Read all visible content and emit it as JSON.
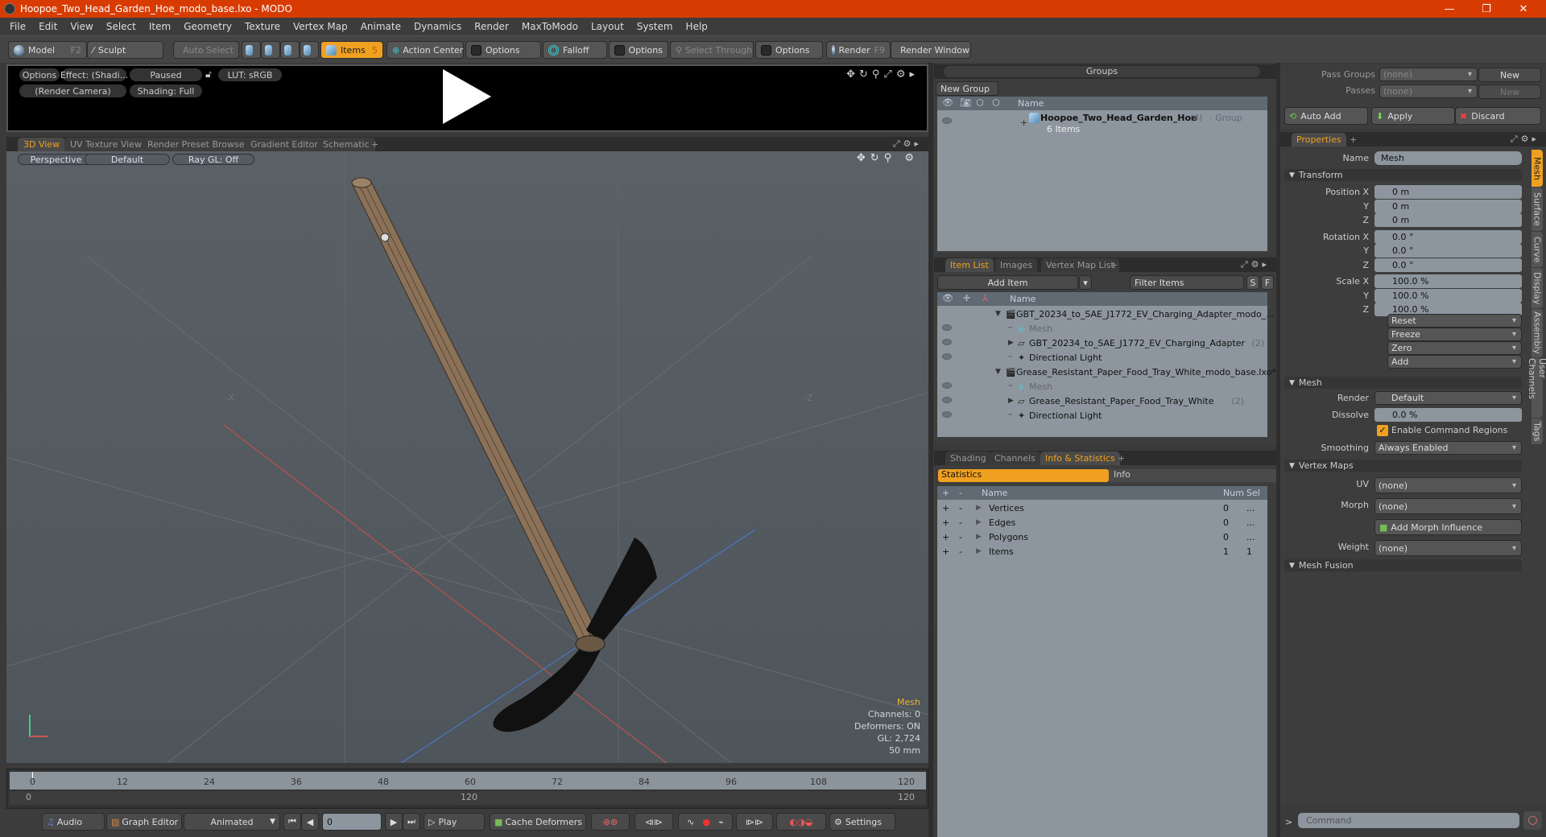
{
  "window": {
    "title": "Hoopoe_Two_Head_Garden_Hoe_modo_base.lxo - MODO",
    "minimize": "—",
    "restore": "❐",
    "close": "✕"
  },
  "menu": [
    "File",
    "Edit",
    "View",
    "Select",
    "Item",
    "Geometry",
    "Texture",
    "Vertex Map",
    "Animate",
    "Dynamics",
    "Render",
    "MaxToModo",
    "Layout",
    "System",
    "Help"
  ],
  "toolbar": {
    "model": "Model",
    "model_key": "F2",
    "sculpt": "Sculpt",
    "auto_select": "Auto Select",
    "items": "Items",
    "items_count": "5",
    "action_center": "Action Center",
    "options1": "Options",
    "falloff": "Falloff",
    "options2": "Options",
    "select_through": "Select Through",
    "options3": "Options",
    "render": "Render",
    "render_key": "F9",
    "render_window": "Render Window"
  },
  "preview": {
    "options": "Options",
    "effect": "Effect: (Shadi...",
    "paused": "Paused",
    "lut": "LUT: sRGB",
    "camera": "(Render Camera)",
    "shading": "Shading: Full"
  },
  "viewport_tabs": [
    "3D View",
    "UV Texture View",
    "Render Preset Browser",
    "Gradient Editor",
    "Schematic",
    "+"
  ],
  "viewport": {
    "projection": "Perspective",
    "style": "Default",
    "raygl": "Ray GL: Off",
    "axis_x": "-X",
    "axis_z": "-Z",
    "overlay": {
      "selection": "Mesh",
      "channels": "Channels: 0",
      "deformers": "Deformers: ON",
      "gl": "GL: 2,724",
      "scale": "50 mm"
    }
  },
  "timeline": {
    "ticks": [
      "0",
      "12",
      "24",
      "36",
      "48",
      "60",
      "72",
      "84",
      "96",
      "108",
      "120"
    ],
    "range_start": "0",
    "range_mid": "120",
    "range_end": "120"
  },
  "bottombar": {
    "audio": "Audio",
    "graph_editor": "Graph Editor",
    "animated": "Animated",
    "frame": "0",
    "play": "Play",
    "cache_deformers": "Cache Deformers",
    "settings": "Settings"
  },
  "groups": {
    "title": "Groups",
    "new_group": "New Group",
    "col_name": "Name",
    "row": {
      "name": "Hoopoe_Two_Head_Garden_Hoe",
      "count": "(4)",
      "type": ": Group",
      "sub": "6 Items"
    }
  },
  "itemlist": {
    "tabs": [
      "Item List",
      "Images",
      "Vertex Map List",
      "+"
    ],
    "add_item": "Add Item",
    "filter": "Filter Items",
    "s": "S",
    "f": "F",
    "col_name": "Name",
    "rows": [
      {
        "text": "GBT_20234_to_SAE_J1772_EV_Charging_Adapter_modo_...",
        "kind": "scene",
        "indent": 0,
        "count": ""
      },
      {
        "text": "Mesh",
        "kind": "mesh",
        "indent": 1,
        "count": ""
      },
      {
        "text": "GBT_20234_to_SAE_J1772_EV_Charging_Adapter",
        "kind": "group",
        "indent": 1,
        "count": "(2)"
      },
      {
        "text": "Directional Light",
        "kind": "light",
        "indent": 1,
        "count": ""
      },
      {
        "text": "Grease_Resistant_Paper_Food_Tray_White_modo_base.lxo*",
        "kind": "scene",
        "indent": 0,
        "count": ""
      },
      {
        "text": "Mesh",
        "kind": "mesh",
        "indent": 1,
        "count": ""
      },
      {
        "text": "Grease_Resistant_Paper_Food_Tray_White",
        "kind": "group",
        "indent": 1,
        "count": "(2)"
      },
      {
        "text": "Directional Light",
        "kind": "light",
        "indent": 1,
        "count": ""
      }
    ]
  },
  "info": {
    "tabs": [
      "Shading",
      "Channels",
      "Info & Statistics",
      "+"
    ],
    "statistics": "Statistics",
    "info": "Info",
    "cols": {
      "plus": "+",
      "minus": "-",
      "name": "Name",
      "num": "Num",
      "sel": "Sel"
    },
    "rows": [
      {
        "name": "Vertices",
        "num": "0",
        "sel": "..."
      },
      {
        "name": "Edges",
        "num": "0",
        "sel": "..."
      },
      {
        "name": "Polygons",
        "num": "0",
        "sel": "..."
      },
      {
        "name": "Items",
        "num": "1",
        "sel": "1"
      }
    ]
  },
  "passes": {
    "pass_groups": "Pass Groups",
    "passes": "Passes",
    "none": "(none)",
    "new": "New",
    "auto_add": "Auto Add",
    "apply": "Apply",
    "discard": "Discard"
  },
  "properties": {
    "tab": "Properties",
    "name_label": "Name",
    "name_value": "Mesh",
    "transform": "Transform",
    "rows": [
      {
        "label": "Position X",
        "value": "0 m"
      },
      {
        "label": "Y",
        "value": "0 m"
      },
      {
        "label": "Z",
        "value": "0 m"
      },
      {
        "label": "Rotation X",
        "value": "0.0 °"
      },
      {
        "label": "Y",
        "value": "0.0 °"
      },
      {
        "label": "Z",
        "value": "0.0 °"
      },
      {
        "label": "Scale X",
        "value": "100.0 %"
      },
      {
        "label": "Y",
        "value": "100.0 %"
      },
      {
        "label": "Z",
        "value": "100.0 %"
      }
    ],
    "actions": [
      "Reset",
      "Freeze",
      "Zero",
      "Add"
    ],
    "mesh": "Mesh",
    "render_label": "Render",
    "render_value": "Default",
    "dissolve_label": "Dissolve",
    "dissolve_value": "0.0 %",
    "command_regions": "Enable Command Regions",
    "smoothing_label": "Smoothing",
    "smoothing_value": "Always Enabled",
    "vertex_maps": "Vertex Maps",
    "uv_label": "UV",
    "morph_label": "Morph",
    "weight_label": "Weight",
    "none": "(none)",
    "add_morph": "Add Morph Influence",
    "mesh_fusion": "Mesh Fusion",
    "side_tabs": [
      "Mesh",
      "Surface",
      "Curve",
      "Display",
      "Assembly",
      "User Channels",
      "Tags"
    ]
  },
  "command": {
    "prompt": ">",
    "placeholder": "Command"
  }
}
